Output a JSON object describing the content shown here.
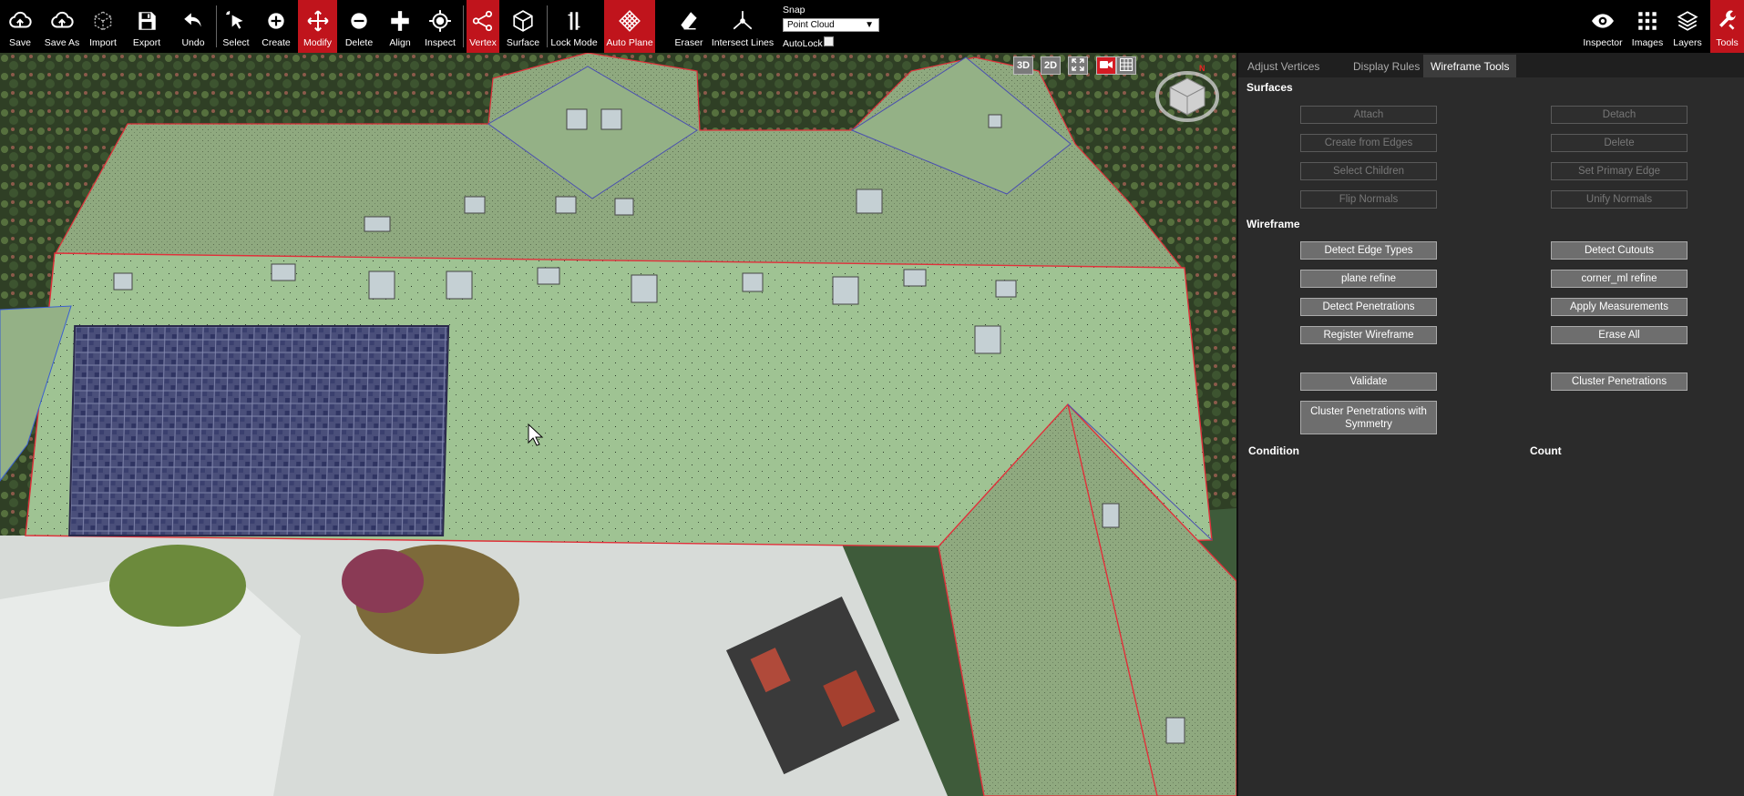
{
  "toolbar": {
    "save": "Save",
    "save_as": "Save As",
    "import": "Import",
    "export": "Export",
    "undo": "Undo",
    "select": "Select",
    "create": "Create",
    "modify": "Modify",
    "delete": "Delete",
    "align": "Align",
    "inspect": "Inspect",
    "vertex": "Vertex",
    "surface": "Surface",
    "lock_mode": "Lock Mode",
    "auto_plane": "Auto Plane",
    "eraser": "Eraser",
    "intersect_lines": "Intersect Lines",
    "snap_label": "Snap",
    "snap_value": "Point Cloud",
    "autolock_label": "AutoLock",
    "inspector": "Inspector",
    "images": "Images",
    "layers": "Layers",
    "tools": "Tools"
  },
  "view_controls": {
    "btn_3d": "3D",
    "btn_2d": "2D",
    "compass_n": "N"
  },
  "panel": {
    "tabs": [
      "Adjust Vertices",
      "Display Rules",
      "Wireframe Tools"
    ],
    "surfaces_heading": "Surfaces",
    "surfaces_buttons": [
      "Attach",
      "Detach",
      "Create from Edges",
      "Delete",
      "Select Children",
      "Set Primary Edge",
      "Flip Normals",
      "Unify Normals"
    ],
    "wireframe_heading": "Wireframe",
    "wireframe_buttons": [
      "Detect Edge Types",
      "Detect Cutouts",
      "plane refine",
      "corner_ml refine",
      "Detect Penetrations",
      "Apply Measurements",
      "Register Wireframe",
      "Erase All"
    ],
    "validate": "Validate",
    "cluster_penetrations": "Cluster Penetrations",
    "cluster_symmetry": "Cluster Penetrations with Symmetry",
    "condition_header": "Condition",
    "count_header": "Count"
  },
  "colors": {
    "active_red": "#c0141c",
    "roof_green": "#97b88c",
    "panel_bg": "#2b2b2b"
  }
}
